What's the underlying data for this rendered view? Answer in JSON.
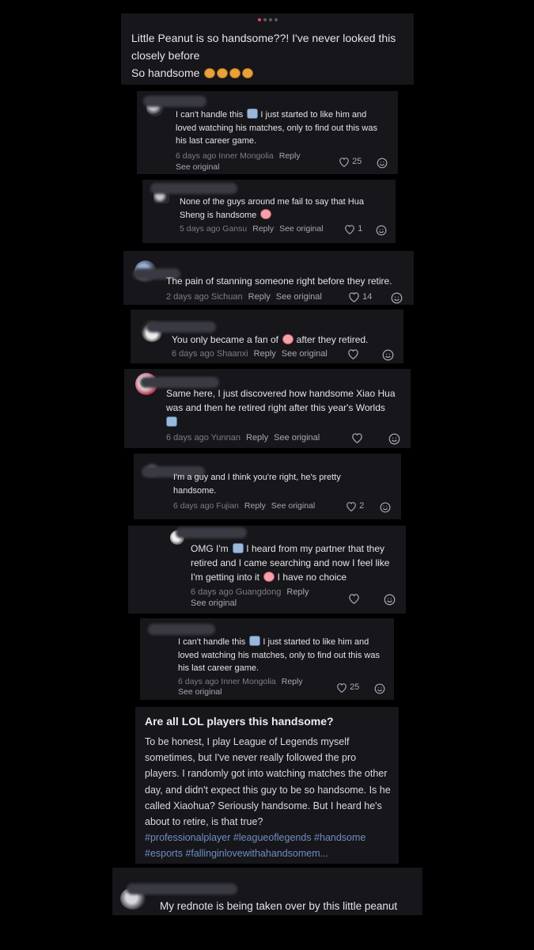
{
  "post": {
    "line1": "Little Peanut is so handsome??! I've never looked this closely before",
    "line2": "So handsome",
    "emojis": [
      "laughing-face",
      "laughing-face",
      "laughing-face",
      "laughing-face"
    ]
  },
  "comments": [
    {
      "text": "I can't handle this ",
      "text2": " I just started to like him and loved watching his matches, only to find out this was his last career game.",
      "meta": "6 days ago Inner Mongolia",
      "reply": "Reply",
      "see_original": "See original",
      "likes": "25"
    },
    {
      "text": "None of the guys around me fail to say that Hua Sheng is handsome ",
      "meta": "5 days ago Gansu",
      "reply": "Reply",
      "see_original": "See original",
      "likes": "1"
    },
    {
      "text": "The pain of stanning someone right before they retire.",
      "meta": "2 days ago Sichuan",
      "reply": "Reply",
      "see_original": "See original",
      "likes": "14"
    },
    {
      "text": "You only became a fan of ",
      "text2": " after they retired.",
      "meta": "6 days ago Shaanxi",
      "reply": "Reply",
      "see_original": "See original",
      "likes": ""
    },
    {
      "text": "Same here, I just discovered how handsome Xiao Hua was and then he retired right after this year's Worlds",
      "meta": "6 days ago Yunnan",
      "reply": "Reply",
      "see_original": "See original",
      "likes": ""
    },
    {
      "text": "I'm a guy and I think you're right, he's pretty handsome.",
      "meta": "6 days ago Fujian",
      "reply": "Reply",
      "see_original": "See original",
      "likes": "2"
    },
    {
      "text": "OMG I'm ",
      "text2": " I heard from my partner that they retired and I came searching and now I feel like I'm getting into it ",
      "text3": " I have no choice",
      "meta": "6 days ago Guangdong",
      "reply": "Reply",
      "see_original": "See original",
      "likes": ""
    },
    {
      "text": "I can't handle this ",
      "text2": " I just started to like him and loved watching his matches, only to find out this was his last career game.",
      "meta": "6 days ago Inner Mongolia",
      "reply": "Reply",
      "see_original": "See original",
      "likes": "25"
    }
  ],
  "topic": {
    "title": "Are all LOL players this handsome?",
    "body": "To be honest, I play League of Legends myself sometimes, but I've never really followed the pro players. I randomly got into watching matches the other day, and didn't expect this guy to be so handsome. Is he called Xiaohua? Seriously handsome. But I heard he's about to retire, is that true?",
    "hashtags": "#professionalplayer #leagueoflegends #handsome #esports #fallinginlovewithahandsomem..."
  },
  "last_comment": {
    "text": "My rednote is being taken over by this little peanut"
  }
}
